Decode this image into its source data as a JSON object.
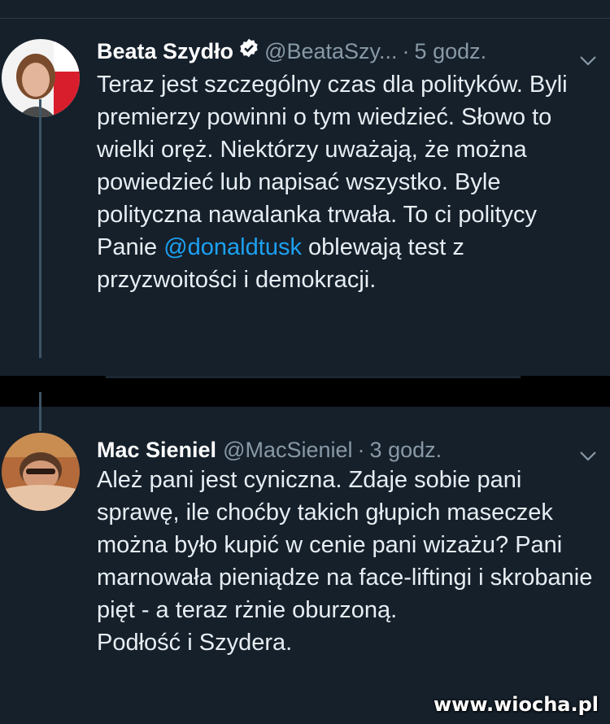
{
  "tweets": [
    {
      "name": "Beata Szydło",
      "handle": "@BeataSzy...",
      "time": "5 godz.",
      "text_pre": "Teraz jest szczególny czas dla polityków. Byli premierzy powinni o tym wiedzieć. Słowo to wielki oręż. Niektórzy uważają, że można powiedzieć lub napisać wszystko. Byle polityczna nawalanka trwała. To ci politycy Panie ",
      "mention": "@donaldtusk",
      "text_post": " oblewają test z przyzwoitości i demokracji.",
      "verified": true
    },
    {
      "name": "Mac Sieniel",
      "handle": "@MacSieniel",
      "time": "3 godz.",
      "lines": [
        "Ależ pani jest cyniczna. Zdaje sobie pani sprawę, ile choćby takich głupich maseczek można było kupić w cenie pani wizażu? Pani marnowała pieniądze na face-liftingi i skrobanie pięt - a teraz rżnie oburzoną.",
        "Podłość i Szydera."
      ],
      "verified": false
    }
  ],
  "separator": "·",
  "watermark": "www.wiocha.pl",
  "colors": {
    "background": "#15202b",
    "text": "#e7edf2",
    "muted": "#8899a6",
    "link": "#1da1f2",
    "verified_badge": "#ffffff"
  },
  "icons": {
    "verified": "verified-badge-icon",
    "menu": "chevron-down-icon"
  }
}
